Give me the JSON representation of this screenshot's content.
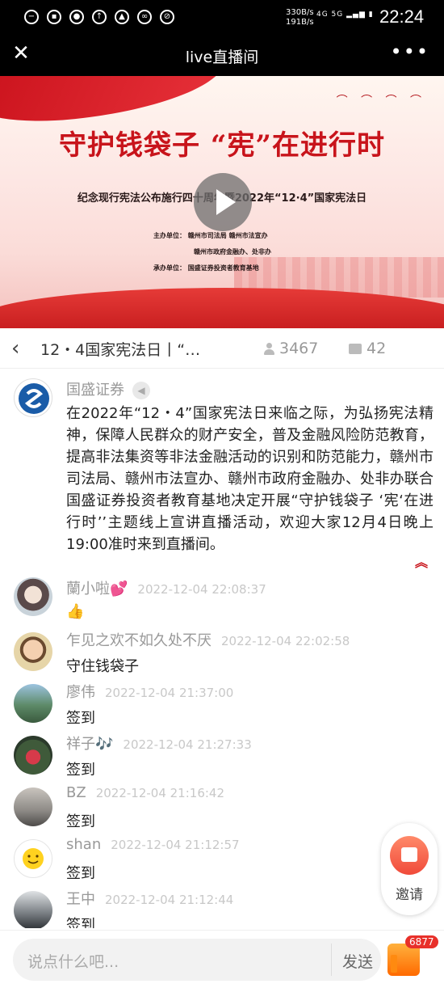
{
  "status_bar": {
    "speed_up": "330B/s",
    "speed_down": "191B/s",
    "network": "4G 5G",
    "time": "22:24"
  },
  "nav": {
    "title": "live直播间"
  },
  "banner": {
    "title": "守护钱袋子 “宪”在进行时",
    "subtitle": "纪念现行宪法公布施行四十周年暨2022年“12·4”国家宪法日",
    "lines": [
      "主办单位： 赣州市司法局 赣州市法宣办",
      "赣州市政府金融办、处非办",
      "承办单位： 国盛证券投资者教育基地"
    ]
  },
  "info": {
    "title": "12・4国家宪法日丨“…",
    "views": "3467",
    "comments": "42"
  },
  "announcement": {
    "author": "国盛证券",
    "text": "在2022年“12・4”国家宪法日来临之际，为弘扬宪法精神，保障人民群众的财产安全，普及金融风险防范教育，提高非法集资等非法金融活动的识别和防范能力，赣州市司法局、赣州市法宣办、赣州市政府金融办、处非办联合国盛证券投资者教育基地决定开展“守护钱袋子 ‘宪‘在进行时’’主题线上宣讲直播活动，欢迎大家12月4日晚上19:00准时来到直播间。"
  },
  "comments": [
    {
      "name": "蘭小啦💕",
      "time": "2022-12-04 22:08:37",
      "text": "👍"
    },
    {
      "name": "乍见之欢不如久处不厌",
      "time": "2022-12-04 22:02:58",
      "text": "守住钱袋子"
    },
    {
      "name": "廖伟",
      "time": "2022-12-04 21:37:00",
      "text": "签到"
    },
    {
      "name": "祥子🎶",
      "time": "2022-12-04 21:27:33",
      "text": "签到"
    },
    {
      "name": "BZ",
      "time": "2022-12-04 21:16:42",
      "text": "签到"
    },
    {
      "name": "shan",
      "time": "2022-12-04 21:12:57",
      "text": "签到"
    },
    {
      "name": "王中",
      "time": "2022-12-04 21:12:44",
      "text": "签到"
    }
  ],
  "invite": {
    "label": "邀请"
  },
  "bottom": {
    "placeholder": "说点什么吧...",
    "send": "发送",
    "likes": "6877"
  },
  "icons": [
    "close-icon",
    "more-icon",
    "play-icon",
    "back-icon",
    "viewers-icon",
    "comment-icon",
    "speaker-icon",
    "collapse-icon",
    "invite-icon",
    "like-icon"
  ],
  "colors": {
    "brand_red": "#c8141b",
    "badge_red": "#e8302a",
    "like_orange": "#ff6a00"
  }
}
